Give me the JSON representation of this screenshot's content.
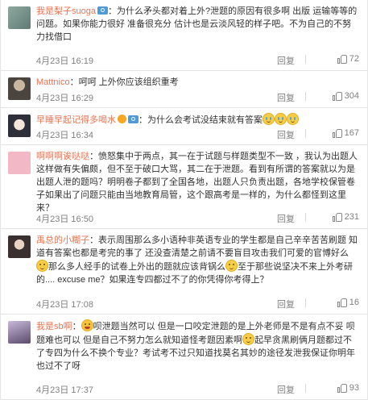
{
  "comments": [
    {
      "user": "我是梨子suoga",
      "text1": "：为什么矛头都对着上外?泄题的原因有很多啊 出版 运输等等的问题。如果你能力很好 准备很充分 估计也是云淡风轻的样子吧。不为自己的不努力找借口",
      "text2": "",
      "time": "4月23日 16:19",
      "reply": "回复",
      "likes": "72"
    },
    {
      "user": "Mattnico",
      "text1": "：呵呵 上外你应该组织重考",
      "text2": "",
      "time": "4月23日 16:29",
      "reply": "回复",
      "likes": "304"
    },
    {
      "user": "早睡早起记得多喝水",
      "text1": "：为什么会考试没结束就有答案",
      "text2": "",
      "time": "4月23日 16:34",
      "reply": "回复",
      "likes": "167"
    },
    {
      "user": "啊啊啊诶哒哒",
      "text1": "：愤怒集中于两点，其一在于试题与样题类型不一致 ，我认为出题人这样做有失偏颇，但不至于破口大骂，其二在于泄题。看到有所谓的答案就以为是出题人泄的题吗？明明卷子都到了全国各地，出题人只负责出题，各地学校保管卷子如果出了问题只能由当地教育局管，这个跟高考是一样的，为什么都怪到这里来？",
      "text2": "",
      "time": "4月23日 16:50",
      "reply": "回复",
      "likes": "231"
    },
    {
      "user": "禹总的小糊子",
      "text1": "：表示周围那么多小语种非英语专业的学生都是自己辛辛苦苦刷题 知道有答案也都是考完的事了 还没查清楚之前请不要盲目攻击我们可爱的官博好么",
      "text2": "那么多人经手的试卷上外出的题就应该背锅么",
      "text3": "至于那些说坚决不来上外考研的.... excuse me？如果连专四都过不了的你凭得你考得上？",
      "time": "4月23日 17:08",
      "reply": "回复",
      "likes": "16"
    },
    {
      "user": "我是sb啊",
      "text1": "：",
      "text2": "呗泄题当然可以 但是一口咬定泄题的是上外老师是不是有点不妥 呗题难也可以 但是自己不努力怎么就知道怪考题因素啊",
      "text3": "起早贪黑刷俩月题都过不了专四为什么不换个专业？考试考不过只知道找莫名其妙的途径发泄我保证你明年也过不了呀",
      "time": "4月23日 17:37",
      "reply": "回复",
      "likes": "93"
    }
  ],
  "icons": {
    "like": "thumbs-up-icon",
    "emoji_smile": "smile-emoji-icon",
    "emoji_cry": "cry-emoji-icon",
    "emoji_lol": "laugh-emoji-icon"
  },
  "colors": {
    "username": "#eb7350",
    "meta": "#808080",
    "divider": "#e4e4e4"
  }
}
